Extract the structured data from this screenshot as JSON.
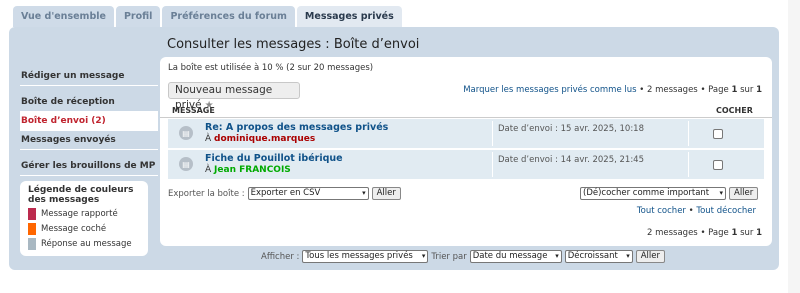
{
  "tabs": [
    "Vue d'ensemble",
    "Profil",
    "Préférences du forum",
    "Messages privés"
  ],
  "page_title": "Consulter les messages : Boîte d’envoi",
  "sidebar": {
    "items": [
      {
        "label": "Rédiger un message"
      },
      {
        "label": "Boîte de réception"
      },
      {
        "label": "Boîte d’envoi (2)"
      },
      {
        "label": "Messages envoyés"
      },
      {
        "label": "Gérer les brouillons de MP"
      }
    ]
  },
  "legend": {
    "title": "Légende de couleurs des messages",
    "items": [
      {
        "label": "Message rapporté",
        "color": "#bc2a4d"
      },
      {
        "label": "Message coché",
        "color": "#ff6600"
      },
      {
        "label": "Réponse au message",
        "color": "#a9b8c2"
      }
    ]
  },
  "usage": "La boîte est utilisée à 10 % (2 sur 20 messages)",
  "new_button": {
    "label": "Nouveau message privé",
    "icon": "plus-icon"
  },
  "pager_top": {
    "mark_read": "Marquer les messages privés comme lus",
    "count": "2 messages",
    "page_prefix": "Page",
    "page": "1",
    "of": "sur",
    "total": "1"
  },
  "table_header": {
    "message": "MESSAGE",
    "check": "COCHER"
  },
  "messages": [
    {
      "subject": "Re: A propos des messages privés",
      "to_prefix": "À",
      "to": "dominique.marques",
      "to_color": "#aa0000",
      "date": "Date d’envoi : 15 avr. 2025, 10:18"
    },
    {
      "subject": "Fiche du Pouillot ibérique",
      "to_prefix": "À",
      "to": "Jean FRANCOIS",
      "to_color": "#00aa00",
      "date": "Date d’envoi : 14 avr. 2025, 21:45"
    }
  ],
  "export": {
    "label": "Exporter la boîte :",
    "selected": "Exporter en CSV",
    "go": "Aller"
  },
  "mark": {
    "selected": "(Dé)cocher comme important",
    "go": "Aller"
  },
  "toggle": {
    "check_all": "Tout cocher",
    "sep": "•",
    "uncheck_all": "Tout décocher"
  },
  "pager_bottom": {
    "count": "2 messages",
    "page_prefix": "Page",
    "page": "1",
    "of": "sur",
    "total": "1"
  },
  "footer": {
    "show_label": "Afficher :",
    "show_selected": "Tous les messages privés",
    "sort_label": "Trier par",
    "sort_selected": "Date du message",
    "order_selected": "Décroissant",
    "go": "Aller"
  }
}
